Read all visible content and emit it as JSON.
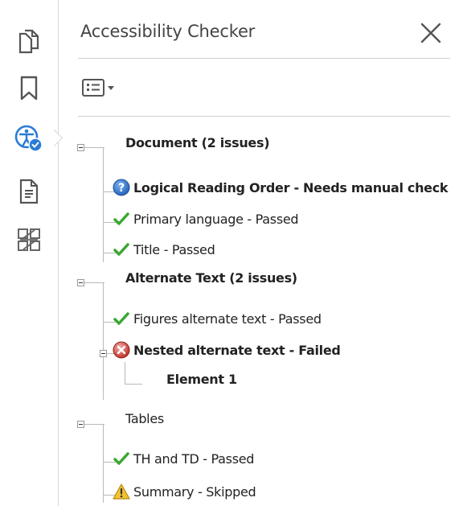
{
  "panel": {
    "title": "Accessibility Checker"
  },
  "rail": {
    "tools": [
      {
        "name": "pages-icon"
      },
      {
        "name": "bookmark-icon"
      },
      {
        "name": "accessibility-icon",
        "active": true
      },
      {
        "name": "document-icon"
      },
      {
        "name": "content-icon"
      }
    ]
  },
  "colors": {
    "accent_blue": "#2b7bd6",
    "pass_green": "#3aa832",
    "fail_red": "#c0302a",
    "warn_yellow": "#f2c230"
  },
  "tree": {
    "groups": [
      {
        "label": "Document (2 issues)",
        "bold": true,
        "items": [
          {
            "label": "Logical Reading Order - Needs manual check",
            "status": "manual",
            "bold": true
          },
          {
            "label": "Primary language - Passed",
            "status": "passed",
            "bold": false
          },
          {
            "label": "Title - Passed",
            "status": "passed",
            "bold": false
          }
        ]
      },
      {
        "label": "Alternate Text (2 issues)",
        "bold": true,
        "items": [
          {
            "label": "Figures alternate text - Passed",
            "status": "passed",
            "bold": false
          },
          {
            "label": "Nested alternate text - Failed",
            "status": "failed",
            "bold": true,
            "children": [
              {
                "label": "Element 1",
                "bold": true
              }
            ]
          }
        ]
      },
      {
        "label": "Tables",
        "bold": false,
        "items": [
          {
            "label": "TH and TD - Passed",
            "status": "passed",
            "bold": false
          },
          {
            "label": "Summary - Skipped",
            "status": "skipped",
            "bold": false
          }
        ]
      }
    ]
  }
}
